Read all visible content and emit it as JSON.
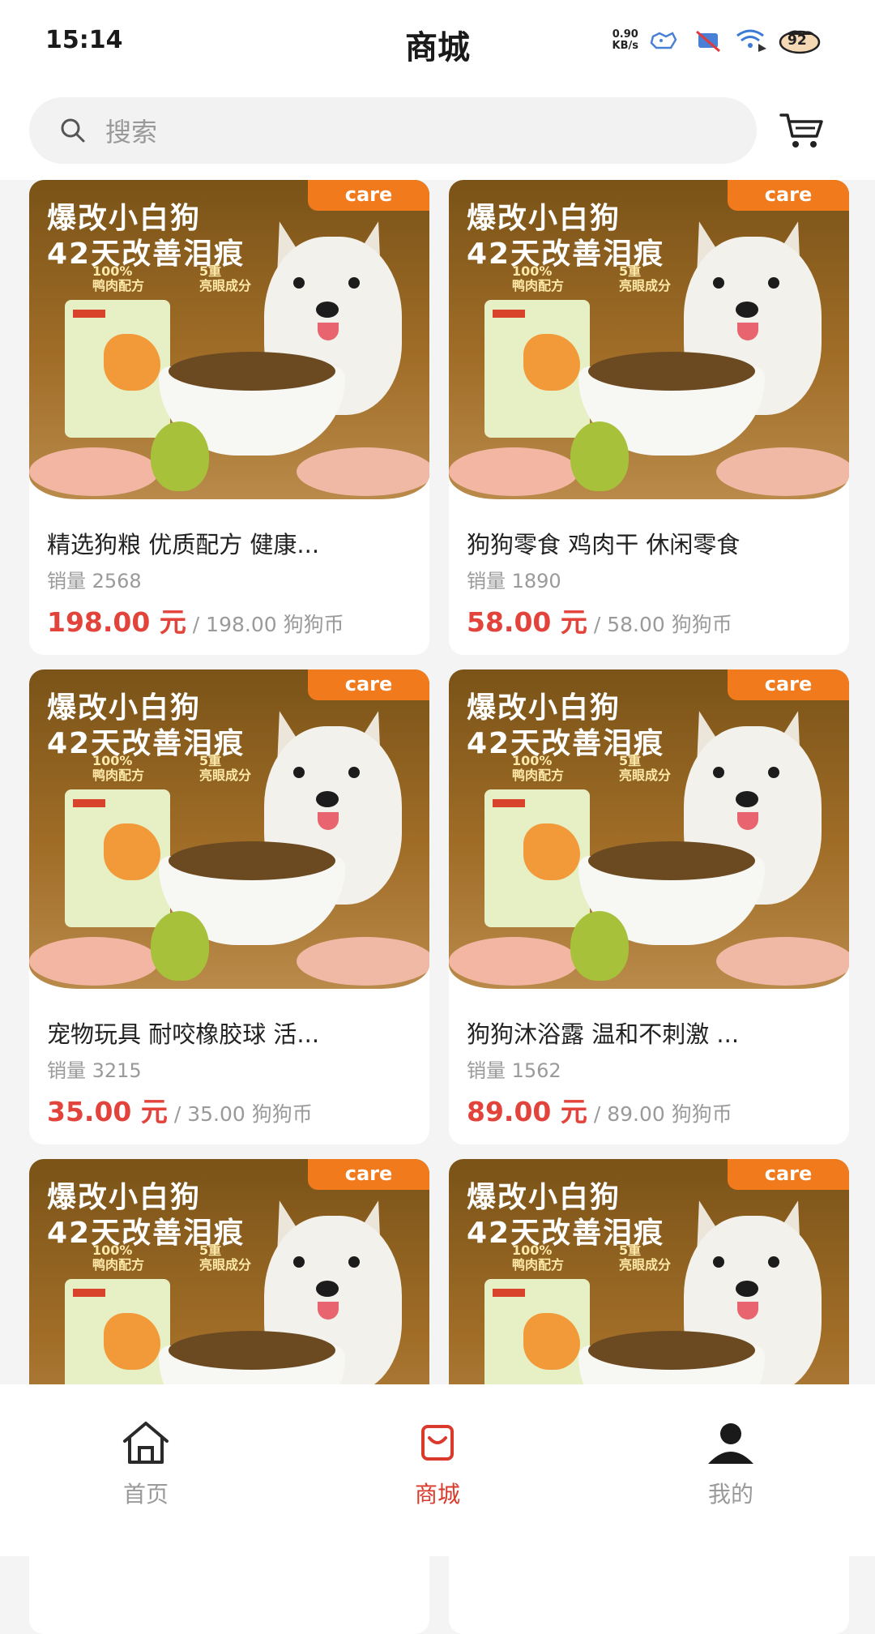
{
  "status_bar": {
    "time": "15:14",
    "net_speed_value": "0.90",
    "net_speed_unit": "KB/s",
    "battery": "92"
  },
  "header": {
    "title": "商城"
  },
  "search": {
    "placeholder": "搜索"
  },
  "products": [
    {
      "title": "精选狗粮 优质配方 健康...",
      "sales": "销量 2568",
      "price": "198.00 元",
      "coin": " / 198.00 狗狗币"
    },
    {
      "title": "狗狗零食 鸡肉干 休闲零食",
      "sales": "销量 1890",
      "price": "58.00 元",
      "coin": " / 58.00 狗狗币"
    },
    {
      "title": "宠物玩具 耐咬橡胶球 活...",
      "sales": "销量 3215",
      "price": "35.00 元",
      "coin": " / 35.00 狗狗币"
    },
    {
      "title": "狗狗沐浴露 温和不刺激 ...",
      "sales": "销量 1562",
      "price": "89.00 元",
      "coin": " / 89.00 狗狗币"
    },
    {
      "title": "",
      "sales": "",
      "price": "",
      "coin": ""
    },
    {
      "title": "",
      "sales": "",
      "price": "",
      "coin": ""
    }
  ],
  "product_image": {
    "banner_line1": "爆改小白狗",
    "banner_line2": "42天改善泪痕",
    "brand": "care",
    "badge1_top": "100%",
    "badge1_bottom": "鸭肉配方",
    "badge2_top": "5重",
    "badge2_bottom": "亮眼成分"
  },
  "tabbar": {
    "items": [
      {
        "label": "首页",
        "icon": "home-icon",
        "active": false
      },
      {
        "label": "商城",
        "icon": "shop-bag-icon",
        "active": true
      },
      {
        "label": "我的",
        "icon": "user-icon",
        "active": false
      }
    ]
  },
  "colors": {
    "accent": "#e2433a",
    "tab_active": "#d93a2b",
    "tab_inactive": "#9a9a9a",
    "background": "#f4f4f4"
  }
}
